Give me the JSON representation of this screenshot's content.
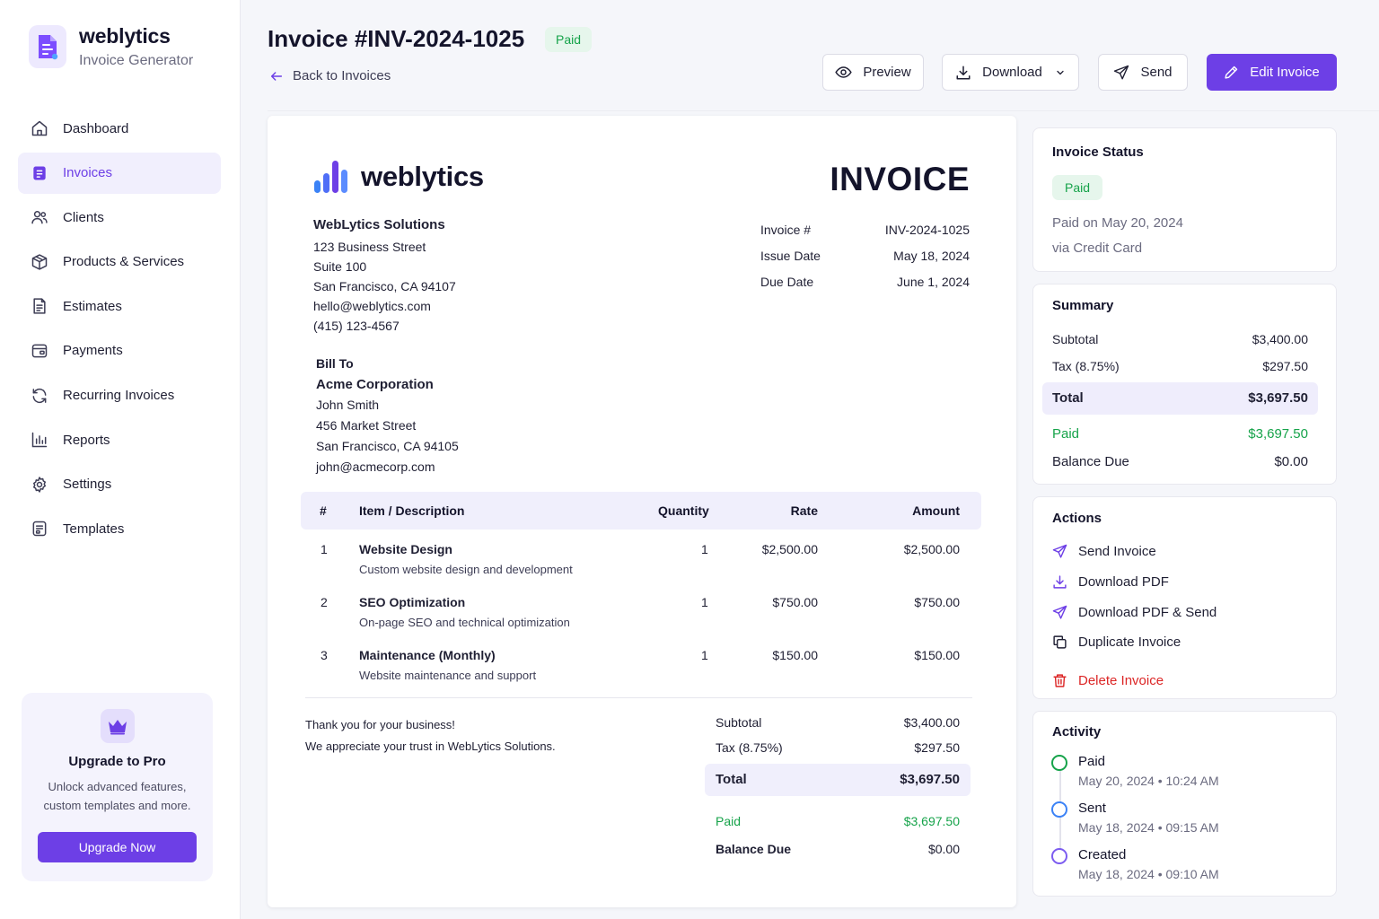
{
  "brand": {
    "name": "weblytics",
    "subtitle": "Invoice Generator"
  },
  "sidebar": {
    "items": [
      {
        "label": "Dashboard",
        "icon": "home-icon"
      },
      {
        "label": "Invoices",
        "icon": "invoice-icon",
        "active": true
      },
      {
        "label": "Clients",
        "icon": "users-icon"
      },
      {
        "label": "Products & Services",
        "icon": "box-icon"
      },
      {
        "label": "Estimates",
        "icon": "document-icon"
      },
      {
        "label": "Payments",
        "icon": "wallet-icon"
      },
      {
        "label": "Recurring Invoices",
        "icon": "refresh-icon"
      },
      {
        "label": "Reports",
        "icon": "bar-chart-icon"
      },
      {
        "label": "Settings",
        "icon": "gear-icon"
      },
      {
        "label": "Templates",
        "icon": "template-icon"
      }
    ],
    "upgrade": {
      "title": "Upgrade to Pro",
      "description": "Unlock advanced features, custom templates and more.",
      "button": "Upgrade Now"
    }
  },
  "header": {
    "title": "Invoice #INV-2024-1025",
    "status": "Paid",
    "back": "Back to Invoices",
    "buttons": {
      "preview": "Preview",
      "download": "Download",
      "send": "Send",
      "edit": "Edit Invoice"
    }
  },
  "invoice": {
    "logo_text": "weblytics",
    "heading": "INVOICE",
    "from": {
      "company": "WebLytics Solutions",
      "lines": [
        "123 Business Street",
        "Suite 100",
        "San Francisco, CA 94107",
        "hello@weblytics.com",
        "(415) 123-4567"
      ]
    },
    "meta": [
      {
        "label": "Invoice #",
        "value": "INV-2024-1025"
      },
      {
        "label": "Issue Date",
        "value": "May 18, 2024"
      },
      {
        "label": "Due Date",
        "value": "June 1, 2024"
      }
    ],
    "bill_to": {
      "label": "Bill To",
      "company": "Acme Corporation",
      "lines": [
        "John Smith",
        "456 Market Street",
        "San Francisco, CA 94105",
        "john@acmecorp.com"
      ]
    },
    "columns": {
      "num": "#",
      "item": "Item / Description",
      "qty": "Quantity",
      "rate": "Rate",
      "amount": "Amount"
    },
    "items": [
      {
        "num": "1",
        "name": "Website Design",
        "desc": "Custom website design and development",
        "qty": "1",
        "rate": "$2,500.00",
        "amount": "$2,500.00"
      },
      {
        "num": "2",
        "name": "SEO Optimization",
        "desc": "On-page SEO and technical optimization",
        "qty": "1",
        "rate": "$750.00",
        "amount": "$750.00"
      },
      {
        "num": "3",
        "name": "Maintenance (Monthly)",
        "desc": "Website maintenance and support",
        "qty": "1",
        "rate": "$150.00",
        "amount": "$150.00"
      }
    ],
    "notes": [
      "Thank you for your business!",
      "We appreciate your trust in WebLytics Solutions."
    ],
    "totals": {
      "subtotal_label": "Subtotal",
      "subtotal": "$3,400.00",
      "tax_label": "Tax (8.75%)",
      "tax": "$297.50",
      "total_label": "Total",
      "total": "$3,697.50",
      "paid_label": "Paid",
      "paid": "$3,697.50",
      "balance_label": "Balance Due",
      "balance": "$0.00"
    }
  },
  "status_card": {
    "title": "Invoice Status",
    "badge": "Paid",
    "paid_on": "Paid on May 20, 2024",
    "method": "via Credit Card"
  },
  "summary_card": {
    "title": "Summary",
    "subtotal_label": "Subtotal",
    "subtotal": "$3,400.00",
    "tax_label": "Tax (8.75%)",
    "tax": "$297.50",
    "total_label": "Total",
    "total": "$3,697.50",
    "paid_label": "Paid",
    "paid": "$3,697.50",
    "balance_label": "Balance Due",
    "balance": "$0.00"
  },
  "actions_card": {
    "title": "Actions",
    "items": [
      "Send Invoice",
      "Download PDF",
      "Download PDF & Send",
      "Duplicate Invoice"
    ],
    "delete": "Delete Invoice"
  },
  "activity_card": {
    "title": "Activity",
    "events": [
      {
        "label": "Paid",
        "time": "May 20, 2024 • 10:24 AM",
        "color": "#16a34a"
      },
      {
        "label": "Sent",
        "time": "May 18, 2024 • 09:15 AM",
        "color": "#3b82f6"
      },
      {
        "label": "Created",
        "time": "May 18, 2024 • 09:10 AM",
        "color": "#7c5cf0"
      }
    ]
  },
  "colors": {
    "accent": "#6d3fe6",
    "success": "#16a34a",
    "danger": "#dc2626"
  }
}
